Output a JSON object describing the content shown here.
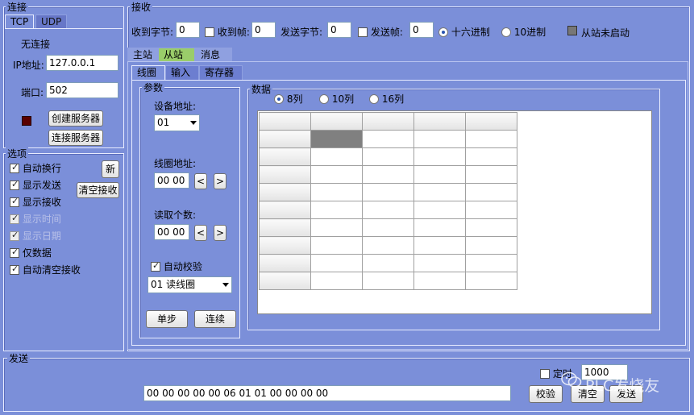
{
  "connection": {
    "title": "连接",
    "tabs": [
      "TCP",
      "UDP"
    ],
    "status": "无连接",
    "ip_label": "IP地址:",
    "ip_value": "127.0.0.1",
    "port_label": "端口:",
    "port_value": "502",
    "create_server": "创建服务器",
    "connect_server": "连接服务器",
    "indicator_color": "#5a0000"
  },
  "options": {
    "title": "选项",
    "new_button": "新",
    "clear_recv_button": "清空接收",
    "items": [
      {
        "label": "自动换行",
        "checked": true,
        "enabled": true
      },
      {
        "label": "显示发送",
        "checked": true,
        "enabled": true
      },
      {
        "label": "显示接收",
        "checked": true,
        "enabled": true
      },
      {
        "label": "显示时间",
        "checked": true,
        "enabled": false
      },
      {
        "label": "显示日期",
        "checked": true,
        "enabled": false
      },
      {
        "label": "仅数据",
        "checked": true,
        "enabled": true
      },
      {
        "label": "自动清空接收",
        "checked": true,
        "enabled": true
      }
    ]
  },
  "receive": {
    "title": "接收",
    "recv_bytes_label": "收到字节:",
    "recv_bytes": "0",
    "recv_frames_label": "收到帧:",
    "recv_frames": "0",
    "send_bytes_label": "发送字节:",
    "send_bytes": "0",
    "send_frames_label": "发送帧:",
    "send_frames": "0",
    "hex_label": "十六进制",
    "dec_label": "10进制",
    "slave_status": "从站未启动"
  },
  "main_tabs": [
    "主站",
    "从站",
    "消息"
  ],
  "sub_tabs": [
    "线圈",
    "输入",
    "寄存器"
  ],
  "params": {
    "title": "参数",
    "device_addr_label": "设备地址:",
    "device_addr": "01",
    "coil_addr_label": "线圈地址:",
    "coil_addr": "00 00",
    "read_count_label": "读取个数:",
    "read_count": "00 00",
    "auto_check_label": "自动校验",
    "function": "01 读线圈",
    "prev": "<",
    "next": ">",
    "step_button": "单步",
    "continuous_button": "连续"
  },
  "data": {
    "title": "数据",
    "col_options": [
      "8列",
      "10列",
      "16列"
    ]
  },
  "send": {
    "title": "发送",
    "timer_label": "定时",
    "timer_value": "1000",
    "payload": "00 00 00 00 00 06 01 01 00 00 00 00",
    "check_button": "校验",
    "clear_button": "清空",
    "send_button": "发送",
    "watermark": "PLC发烧友"
  }
}
